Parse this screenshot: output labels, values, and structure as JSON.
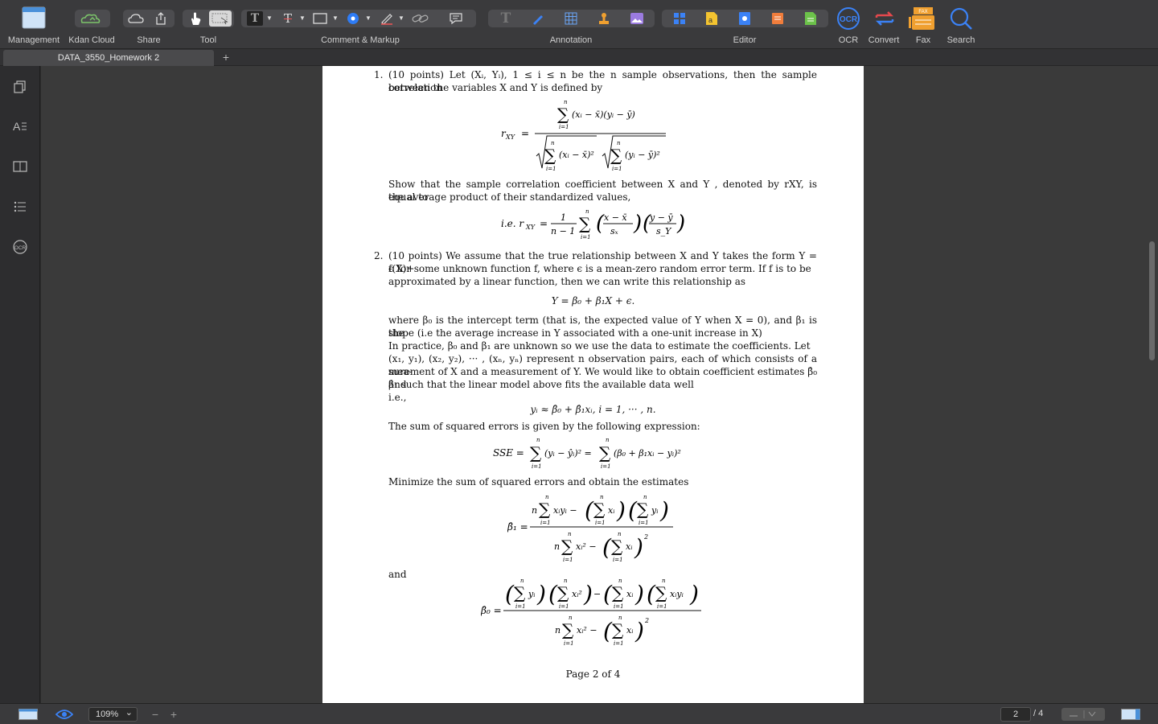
{
  "toolbar": {
    "management": "Management",
    "kdan_cloud": "Kdan Cloud",
    "share": "Share",
    "tool": "Tool",
    "comment_markup": "Comment & Markup",
    "annotation": "Annotation",
    "editor": "Editor",
    "ocr": "OCR",
    "convert": "Convert",
    "fax": "Fax",
    "search": "Search",
    "fax_badge": "FAX",
    "ocr_glyph": "OCR"
  },
  "tabs": [
    {
      "label": "DATA_3550_Homework 2"
    }
  ],
  "tab_add": "+",
  "document": {
    "q1_number": "1.",
    "q1_intro": "(10 points)  Let (X",
    "q1_line1_full": "(10 points)  Let (Xᵢ, Yᵢ), 1 ≤ i ≤ n be the n sample observations, then the sample correlation",
    "q1_line2": "between the variables X and Y is defined by",
    "q1_show1": "Show that the sample correlation coefficient between X and Y , denoted by r",
    "q1_show_full1": "Show that the sample correlation coefficient between X and Y , denoted by rXY, is equal to",
    "q1_show_full2": "the average product of their standardized values,",
    "q1_ie": "i.e. r",
    "q2_number": "2.",
    "q2_line1": "(10 points)  We assume that the true relationship between X and Y takes the form Y = f(X)+",
    "q2_line2": "ϵ for some unknown function f, where ϵ is a mean-zero random error term.  If f is to be",
    "q2_line3": "approximated by a linear function, then we can write this relationship as",
    "q2_eq": "Y = β₀ + β₁X + ϵ.",
    "q2_p1": "where β₀ is the intercept term (that is, the expected value of Y when X = 0), and β₁ is the",
    "q2_p2": "slope (i.e the average increase in Y associated with a one-unit increase in X)",
    "q2_p3": "In practice, β₀ and β₁ are unknown so we use the data to estimate the coefficients.  Let",
    "q2_p4": "(x₁, y₁), (x₂, y₂), ··· , (xₙ, yₙ) represent n observation pairs, each of which consists of a mea-",
    "q2_p5": "surement of X and a measurement of Y. We would like to obtain coefficient estimates β̂₀ and",
    "q2_p6": "β̂₁ such that the linear model above fits the available data well",
    "q2_ie": "i.e.,",
    "q2_approx": "yᵢ ≈ β̂₀ + β̂₁xᵢ,    i = 1, ··· , n.",
    "q2_sse_intro": "The sum of squared errors is given by the following expression:",
    "q2_minimize": "Minimize the sum of squared errors and obtain the estimates",
    "q2_and": "and",
    "page_footer": "Page 2 of 4"
  },
  "status": {
    "zoom": "109%",
    "zoom_caret": "⌄",
    "page_current": "2",
    "page_total": "/ 4",
    "zoom_out": "−",
    "zoom_in": "+"
  },
  "colors": {
    "toolbar_bg": "#3a3a3c",
    "accent_blue": "#2e7cf6",
    "ocr_blue": "#3b82f6",
    "convert_red": "#e5484d",
    "fax_orange": "#f0a030"
  }
}
